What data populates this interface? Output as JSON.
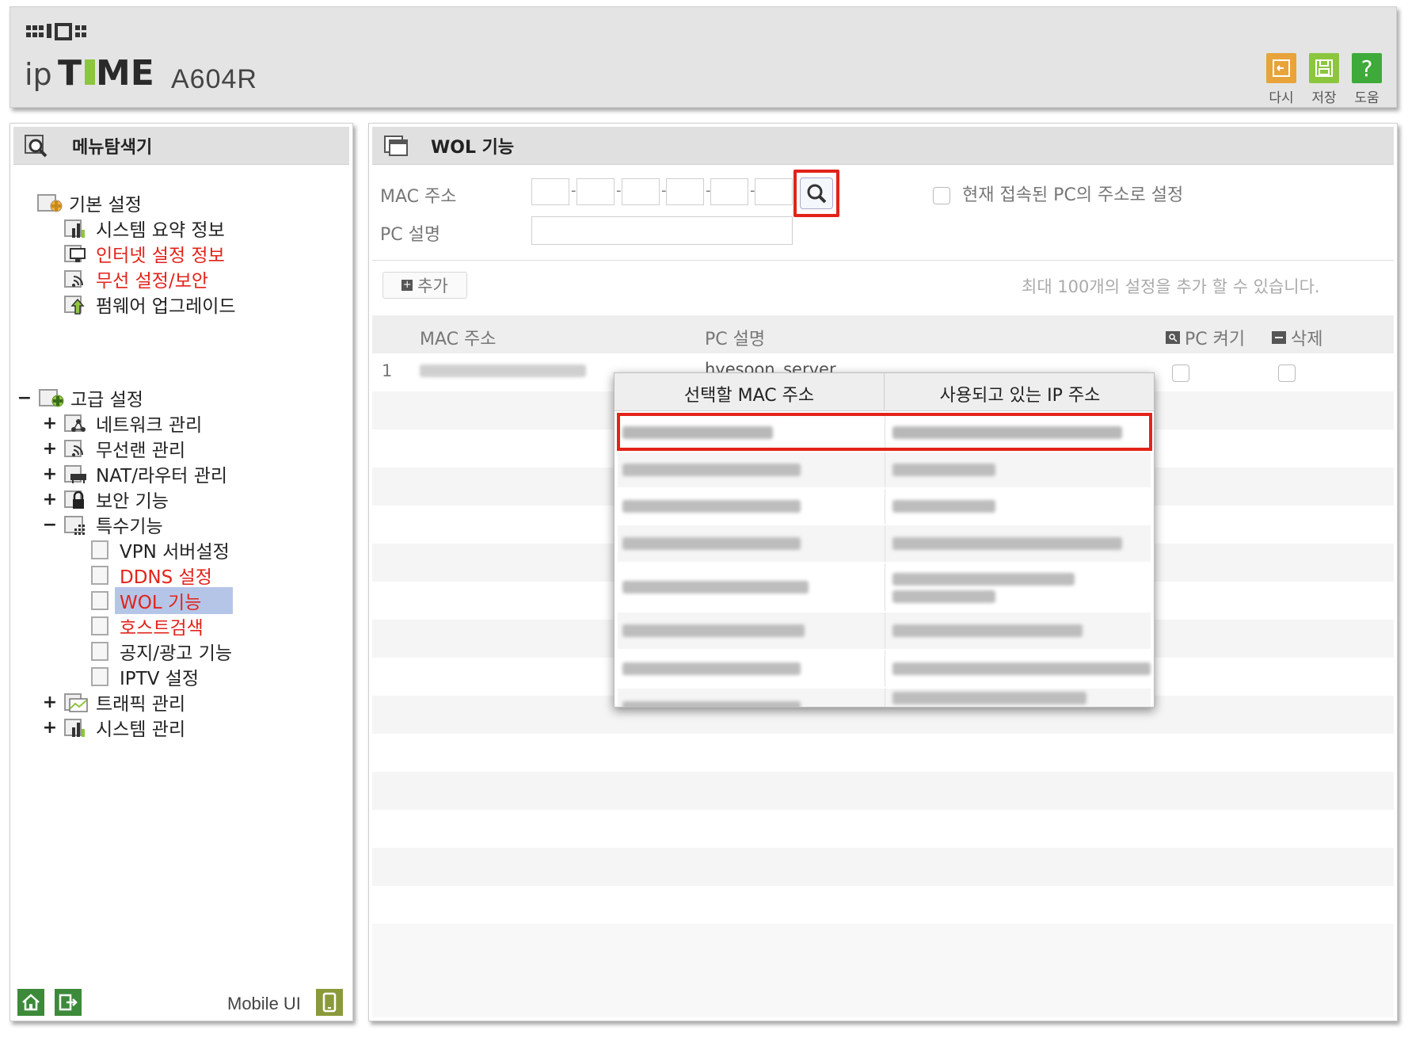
{
  "header": {
    "model": "A604R",
    "buttons": [
      {
        "label": "다시",
        "icon": "undo-icon",
        "color": "#e8a33a"
      },
      {
        "label": "저장",
        "icon": "save-icon",
        "color": "#8cc63e"
      },
      {
        "label": "도움",
        "icon": "help-icon",
        "color": "#3eaa3a"
      }
    ]
  },
  "sidebar": {
    "title": "메뉴탐색기",
    "basic": {
      "label": "기본 설정",
      "items": [
        "시스템 요약 정보",
        "인터넷 설정 정보",
        "무선 설정/보안",
        "펌웨어 업그레이드"
      ]
    },
    "advanced": {
      "expander": "−",
      "label": "고급 설정",
      "groups": [
        {
          "exp": "+",
          "label": "네트워크 관리"
        },
        {
          "exp": "+",
          "label": "무선랜 관리"
        },
        {
          "exp": "+",
          "label": "NAT/라우터 관리"
        },
        {
          "exp": "+",
          "label": "보안 기능"
        },
        {
          "exp": "−",
          "label": "특수기능"
        }
      ],
      "special_items": [
        "VPN 서버설정",
        "DDNS 설정",
        "WOL 기능",
        "호스트검색",
        "공지/광고 기능",
        "IPTV 설정"
      ],
      "tail_groups": [
        {
          "exp": "+",
          "label": "트래픽 관리"
        },
        {
          "exp": "+",
          "label": "시스템 관리"
        }
      ]
    },
    "footer": {
      "mobile_label": "Mobile UI"
    }
  },
  "main": {
    "title": "WOL 기능",
    "mac_label": "MAC 주소",
    "pc_desc_label": "PC 설명",
    "current_pc_label": "현재 접속된 PC의 주소로 설정",
    "add_button": "추가",
    "add_button_prefix": "+",
    "hint": "최대 100개의 설정을 추가 할 수 있습니다.",
    "table": {
      "columns": [
        "MAC 주소",
        "PC 설명",
        "PC 켜기",
        "삭제"
      ],
      "rows": [
        {
          "index": "1",
          "desc": "hyesoon_server"
        }
      ]
    }
  },
  "popup": {
    "columns": [
      "선택할 MAC 주소",
      "사용되고 있는 IP 주소"
    ]
  }
}
